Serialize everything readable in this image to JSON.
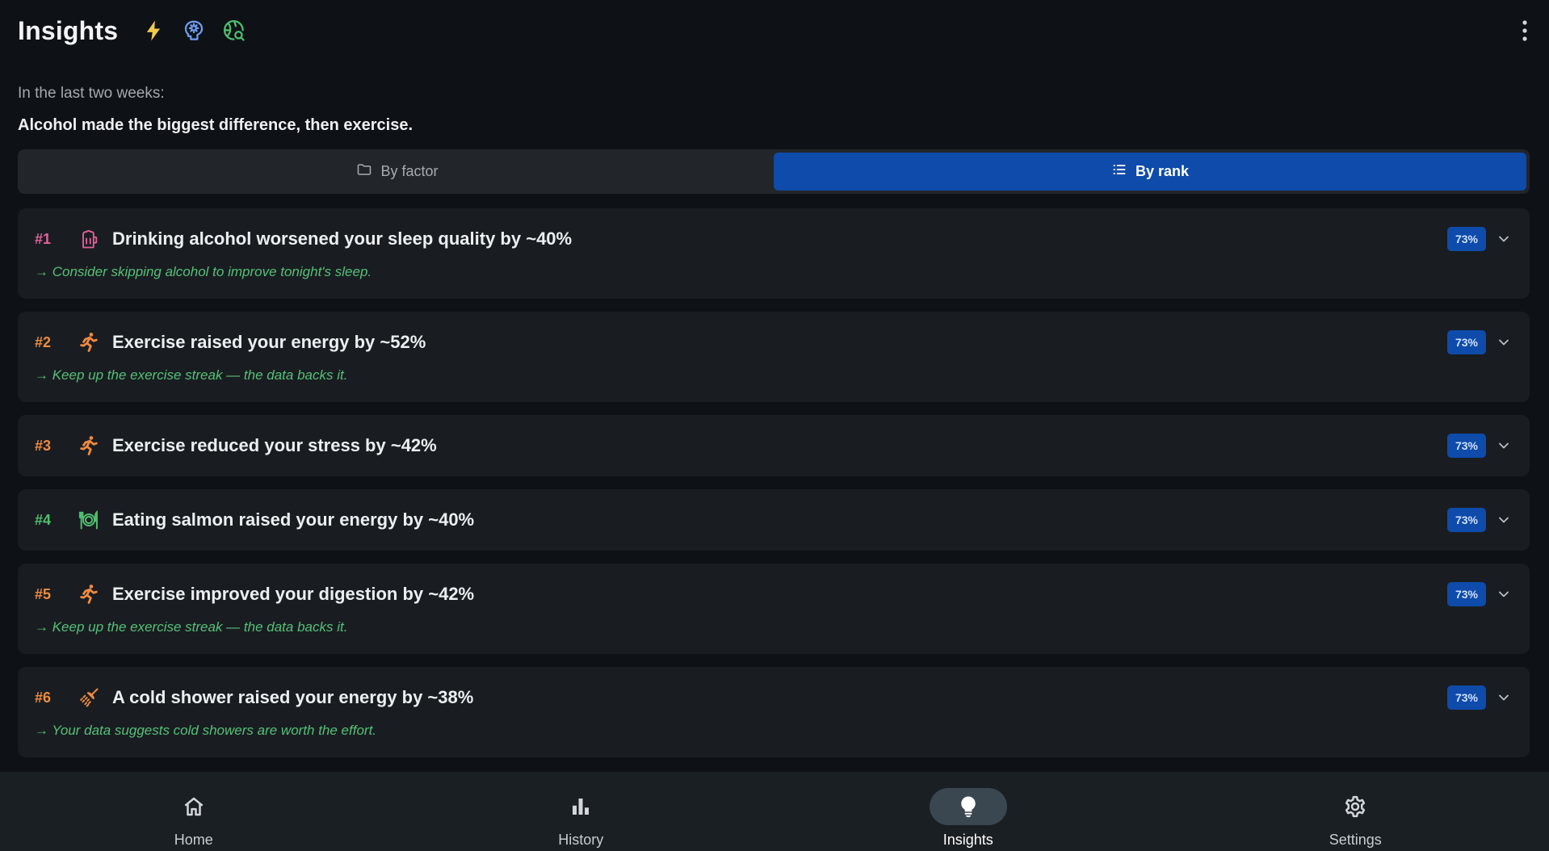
{
  "header": {
    "title": "Insights",
    "icons": [
      "lightning-icon",
      "brain-icon",
      "globe-search-icon"
    ],
    "menu_icon": "more-vert-icon"
  },
  "intro": {
    "period": "In the last two weeks:",
    "summary": "Alcohol made the biggest difference, then exercise."
  },
  "segment": {
    "options": [
      {
        "label": "By factor",
        "icon": "folder-icon",
        "selected": false
      },
      {
        "label": "By rank",
        "icon": "list-icon",
        "selected": true
      }
    ]
  },
  "insights": [
    {
      "rank": "#1",
      "icon": "beer-mug-icon",
      "rank_color": "#e0619a",
      "title": "Drinking alcohol worsened your sleep quality by ~40%",
      "confidence": "73%",
      "advice": "→ Consider skipping alcohol to improve tonight's sleep."
    },
    {
      "rank": "#2",
      "icon": "runner-icon",
      "rank_color": "#f08a3e",
      "title": "Exercise raised your energy by ~52%",
      "confidence": "73%",
      "advice": "→ Keep up the exercise streak — the data backs it."
    },
    {
      "rank": "#3",
      "icon": "runner-icon",
      "rank_color": "#f08a3e",
      "title": "Exercise reduced your stress by ~42%",
      "confidence": "73%",
      "advice": ""
    },
    {
      "rank": "#4",
      "icon": "plate-cutlery-icon",
      "rank_color": "#4fbf6e",
      "title": "Eating salmon raised your energy by ~40%",
      "confidence": "73%",
      "advice": ""
    },
    {
      "rank": "#5",
      "icon": "runner-icon",
      "rank_color": "#f08a3e",
      "title": "Exercise improved your digestion by ~42%",
      "confidence": "73%",
      "advice": "→ Keep up the exercise streak — the data backs it."
    },
    {
      "rank": "#6",
      "icon": "shower-icon",
      "rank_color": "#f08a3e",
      "title": "A cold shower raised your energy by ~38%",
      "confidence": "73%",
      "advice": "→ Your data suggests cold showers are worth the effort."
    }
  ],
  "nav": [
    {
      "label": "Home",
      "icon": "home-icon",
      "active": false
    },
    {
      "label": "History",
      "icon": "bar-chart-icon",
      "active": false
    },
    {
      "label": "Insights",
      "icon": "lightbulb-icon",
      "active": true
    },
    {
      "label": "Settings",
      "icon": "gear-icon",
      "active": false
    }
  ],
  "colors": {
    "background": "#0e1216",
    "card": "#191d21",
    "accent": "#0e4baa",
    "advice": "#55c078"
  }
}
